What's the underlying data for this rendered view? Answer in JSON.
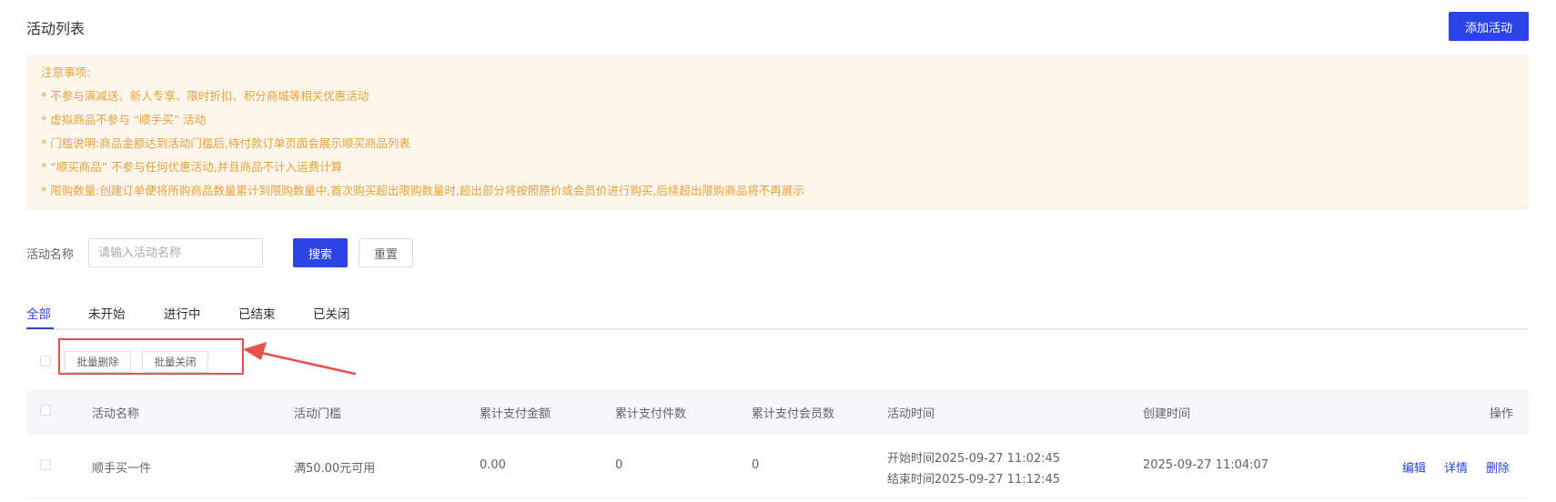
{
  "header": {
    "title": "活动列表",
    "add_button": "添加活动"
  },
  "notice": {
    "title": "注意事项:",
    "lines": [
      "* 不参与满减送、新人专享、限时折扣、积分商城等相关优惠活动",
      "* 虚拟商品不参与 “顺手买” 活动",
      "* 门槛说明:商品金额达到活动门槛后,待付款订单页面会展示顺买商品列表",
      "* “顺买商品” 不参与任何优惠活动,并且商品不计入运费计算",
      "* 限购数量:创建订单便将所购商品数量累计到限购数量中,首次购买超出限购数量时,超出部分将按照原价或会员价进行购买,后续超出限购商品将不再展示"
    ]
  },
  "filter": {
    "label": "活动名称",
    "placeholder": "请输入活动名称",
    "value": "",
    "search_button": "搜索",
    "reset_button": "重置"
  },
  "tabs": [
    {
      "label": "全部",
      "active": true
    },
    {
      "label": "未开始",
      "active": false
    },
    {
      "label": "进行中",
      "active": false
    },
    {
      "label": "已结束",
      "active": false
    },
    {
      "label": "已关闭",
      "active": false
    }
  ],
  "batch": {
    "delete": "批量删除",
    "close": "批量关闭"
  },
  "table": {
    "columns": [
      "活动名称",
      "活动门槛",
      "累计支付金额",
      "累计支付件数",
      "累计支付会员数",
      "活动时间",
      "创建时间",
      "操作"
    ],
    "rows": [
      {
        "name": "顺手买一件",
        "threshold": "满50.00元可用",
        "amount": "0.00",
        "count": "0",
        "members": "0",
        "start": "开始时间2025-09-27 11:02:45",
        "end": "结束时间2025-09-27 11:12:45",
        "created": "2025-09-27 11:04:07",
        "actions": [
          "编辑",
          "详情",
          "删除"
        ]
      }
    ]
  },
  "colors": {
    "primary": "#2b44e8",
    "notice_bg": "#fdf6ec",
    "notice_text": "#e6a23c",
    "highlight": "#e84f4f"
  }
}
